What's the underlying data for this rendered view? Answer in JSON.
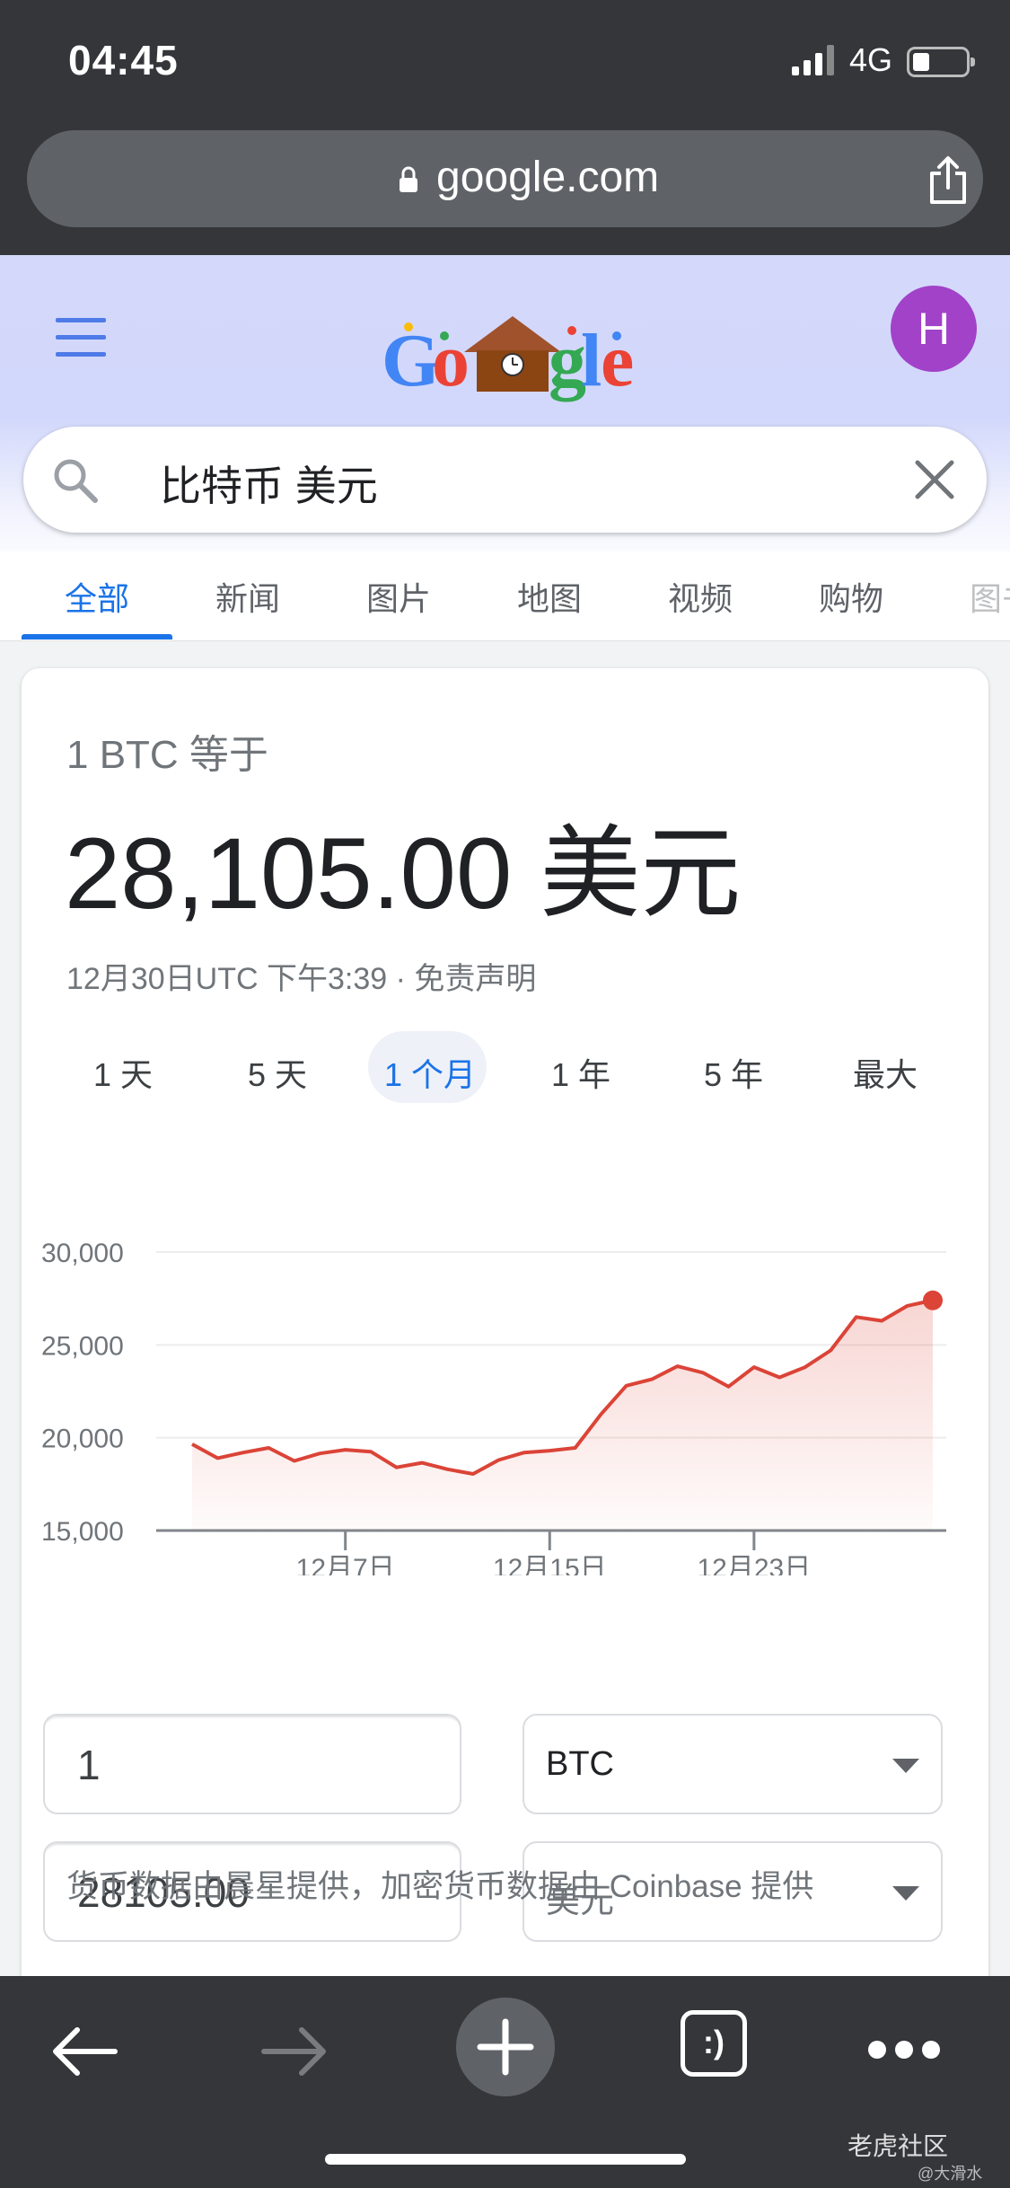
{
  "status_bar": {
    "time": "04:45",
    "network": "4G",
    "signal_icon": "cellular-signal-icon",
    "battery_icon": "battery-icon"
  },
  "browser": {
    "url": "google.com",
    "lock_icon": "lock-icon",
    "share_icon": "share-icon"
  },
  "header": {
    "avatar_letter": "H",
    "doodle_text": "Google"
  },
  "search": {
    "query": "比特币 美元"
  },
  "tabs": [
    {
      "label": "全部",
      "active": true
    },
    {
      "label": "新闻"
    },
    {
      "label": "图片"
    },
    {
      "label": "地图"
    },
    {
      "label": "视频"
    },
    {
      "label": "购物"
    },
    {
      "label": "图书"
    }
  ],
  "card": {
    "equals_label": "1 BTC 等于",
    "price": "28,105.00 美元",
    "meta": "12月30日UTC 下午3:39 · 免责声明"
  },
  "ranges": [
    {
      "label": "1 天"
    },
    {
      "label": "5 天"
    },
    {
      "label": "1 个月",
      "active": true
    },
    {
      "label": "1 年"
    },
    {
      "label": "5 年"
    },
    {
      "label": "最大"
    }
  ],
  "chart_data": {
    "type": "area",
    "y_ticks": [
      "30,000",
      "25,000",
      "20,000",
      "15,000"
    ],
    "ylim": [
      15000,
      30000
    ],
    "x_ticks": [
      {
        "label": "12月7日",
        "day": 7
      },
      {
        "label": "12月15日",
        "day": 15
      },
      {
        "label": "12月23日",
        "day": 23
      }
    ],
    "x_unit": "December day",
    "series": [
      {
        "color": "#db4437",
        "x": [
          1,
          2,
          3,
          4,
          5,
          6,
          7,
          8,
          9,
          10,
          11,
          12,
          13,
          14,
          15,
          16,
          17,
          18,
          19,
          20,
          21,
          22,
          23,
          24,
          25,
          26,
          27,
          28,
          29,
          30
        ],
        "values": [
          19650,
          18900,
          19200,
          19450,
          18750,
          19150,
          19350,
          19250,
          18400,
          18650,
          18300,
          18050,
          18800,
          19200,
          19300,
          19450,
          21250,
          22800,
          23150,
          23850,
          23500,
          22750,
          23800,
          23250,
          23800,
          24700,
          26500,
          26300,
          27100,
          27400
        ]
      }
    ]
  },
  "converter": {
    "amount": "1",
    "from_currency": "BTC",
    "result": "28105.00",
    "to_currency": "美元"
  },
  "source_note": "货币数据由晨星提供，加密货币数据由 Coinbase 提供",
  "toolbar": {
    "tabs_glyph": ":)"
  },
  "watermark": {
    "text": "老虎社区",
    "sub": "@大滑水"
  }
}
